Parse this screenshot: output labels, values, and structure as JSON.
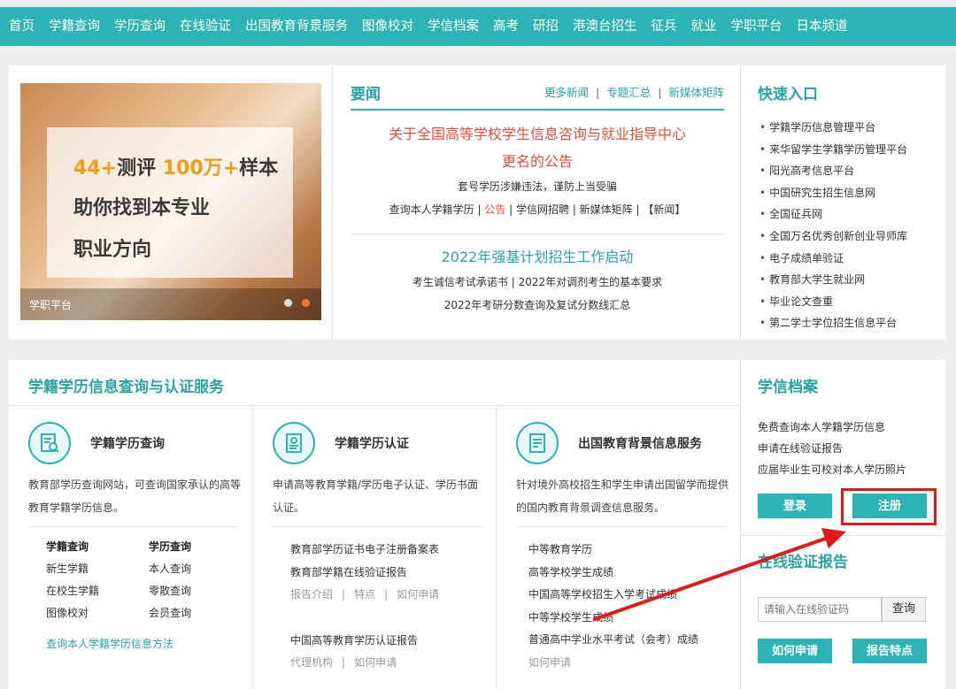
{
  "nav": {
    "items": [
      "首页",
      "学籍查询",
      "学历查询",
      "在线验证",
      "出国教育背景服务",
      "图像校对",
      "学信档案",
      "高考",
      "研招",
      "港澳台招生",
      "征兵",
      "就业",
      "学职平台",
      "日本频道"
    ]
  },
  "banner": {
    "line1_a": "44+",
    "line1_b": "测评 ",
    "line1_c": "100万+",
    "line1_d": "样本",
    "line2": "助你找到本专业",
    "line3": "职业方向",
    "caption": "学职平台"
  },
  "news": {
    "title": "要闻",
    "links": [
      "更多新闻",
      "专题汇总",
      "新媒体矩阵"
    ],
    "headline1_line1": "关于全国高等学校学生信息咨询与就业指导中心",
    "headline1_line2": "更名的公告",
    "sub1": "套号学历涉嫌违法，谨防上当受骗",
    "sub2_a": "查询本人学籍学历 | ",
    "sub2_b": "公告",
    "sub2_c": " | 学信网招聘 | 新媒体矩阵 | 【新闻】",
    "headline2": "2022年强基计划招生工作启动",
    "sub3": "考生诚信考试承诺书 | 2022年对调剂考生的基本要求",
    "sub4": "2022年考研分数查询及复试分数线汇总"
  },
  "quick": {
    "title": "快速入口",
    "items": [
      "学籍学历信息管理平台",
      "来华留学生学籍学历管理平台",
      "阳光高考信息平台",
      "中国研究生招生信息网",
      "全国征兵网",
      "全国万名优秀创新创业导师库",
      "电子成绩单验证",
      "教育部大学生就业网",
      "毕业论文查重",
      "第二学士学位招生信息平台"
    ]
  },
  "services": {
    "title": "学籍学历信息查询与认证服务",
    "col1": {
      "name": "学籍学历查询",
      "desc": "教育部学历查询网站，可查询国家承认的高等教育学籍学历信息。",
      "grid": [
        [
          "学籍查询",
          "学历查询"
        ],
        [
          "新生学籍",
          "本人查询"
        ],
        [
          "在校生学籍",
          "零散查询"
        ],
        [
          "图像校对",
          "会员查询"
        ]
      ],
      "method_link": "查询本人学籍学历信息方法"
    },
    "col2": {
      "name": "学籍学历认证",
      "desc": "申请高等教育学籍/学历电子认证、学历书面认证。",
      "item1": "教育部学历证书电子注册备案表",
      "item2": "教育部学籍在线验证报告",
      "sub_links": [
        "报告介绍",
        "特点",
        "如何申请"
      ],
      "item3": "中国高等教育学历认证报告",
      "sub_links2": [
        "代理机构",
        "如何申请"
      ]
    },
    "col3": {
      "name": "出国教育背景信息服务",
      "desc": "针对境外高校招生和学生申请出国留学而提供的国内教育背景调查信息服务。",
      "items": [
        "中等教育学历",
        "高等学校学生成绩",
        "中国高等学校招生入学考试成绩",
        "中等学校学生成绩",
        "普通高中学业水平考试（会考）成绩",
        "如何申请"
      ]
    }
  },
  "xuexin": {
    "title": "学信档案",
    "items": [
      "免费查询本人学籍学历信息",
      "申请在线验证报告",
      "应届毕业生可校对本人学历照片"
    ],
    "login_label": "登录",
    "register_label": "注册"
  },
  "verify": {
    "title": "在线验证报告",
    "placeholder": "请输入在线验证码",
    "query_label": "查询",
    "how_label": "如何申请",
    "feature_label": "报告特点"
  },
  "colors": {
    "teal": "#2cb3b3",
    "red_annotation": "#e01919",
    "news_red": "#e04f3a",
    "accent_orange": "#f39a18"
  }
}
